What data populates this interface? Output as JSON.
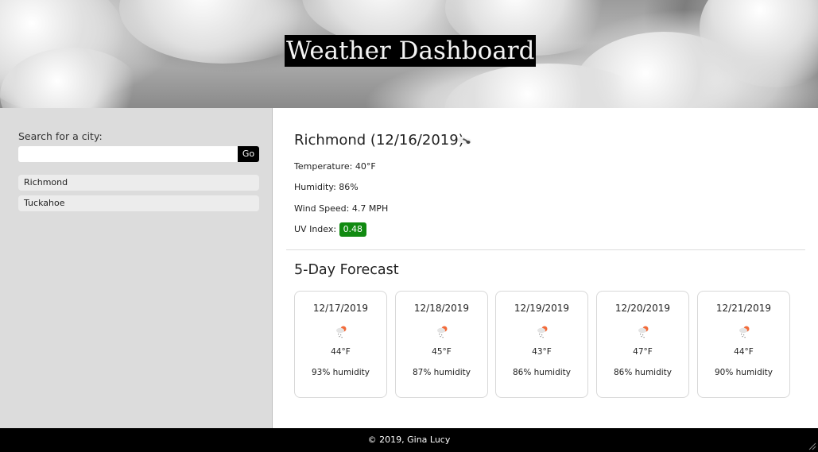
{
  "header": {
    "title": "Weather Dashboard"
  },
  "sidebar": {
    "search_label": "Search for a city:",
    "search_value": "",
    "search_placeholder": "",
    "go_label": "Go",
    "history": [
      {
        "label": "Richmond"
      },
      {
        "label": "Tuckahoe"
      }
    ]
  },
  "current": {
    "title": "Richmond (12/16/2019)",
    "icon": "cloudy-icon",
    "temperature_label": "Temperature: 40°F",
    "humidity_label": "Humidity: 86%",
    "wind_label": "Wind Speed: 4.7 MPH",
    "uv_label": "UV Index:",
    "uv_value": "0.48",
    "uv_color": "#118a11"
  },
  "forecast": {
    "title": "5-Day Forecast",
    "icon": "rain-sun-icon",
    "days": [
      {
        "date": "12/17/2019",
        "temp": "44°F",
        "humidity": "93% humidity"
      },
      {
        "date": "12/18/2019",
        "temp": "45°F",
        "humidity": "87% humidity"
      },
      {
        "date": "12/19/2019",
        "temp": "43°F",
        "humidity": "86% humidity"
      },
      {
        "date": "12/20/2019",
        "temp": "47°F",
        "humidity": "86% humidity"
      },
      {
        "date": "12/21/2019",
        "temp": "44°F",
        "humidity": "90% humidity"
      }
    ]
  },
  "footer": {
    "text": "© 2019, Gina Lucy"
  },
  "colors": {
    "footer_bg": "#000000",
    "sidebar_bg": "#dcdcdc",
    "go_button_bg": "#000000"
  }
}
